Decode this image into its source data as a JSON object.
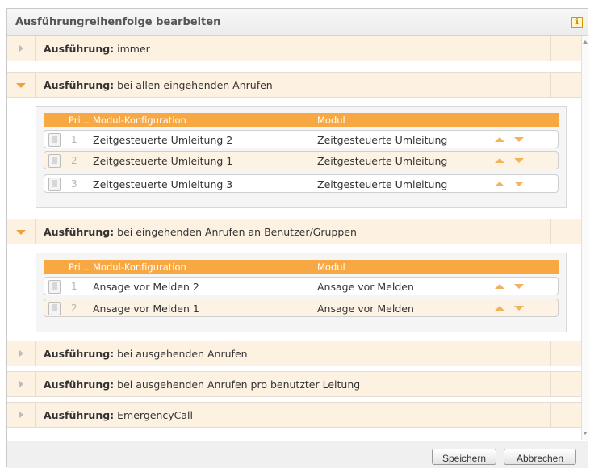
{
  "dialog": {
    "title": "Ausführungreihenfolge bearbeiten",
    "info_icon": "i"
  },
  "groups": [
    {
      "prefix": "Ausführung:",
      "name": "immer",
      "expanded": false
    },
    {
      "prefix": "Ausführung:",
      "name": "bei allen eingehenden Anrufen",
      "expanded": true,
      "columns": {
        "priority": "Pri...",
        "config": "Modul-Konfiguration",
        "module": "Modul"
      },
      "rows": [
        {
          "prio": "1",
          "config": "Zeitgesteuerte Umleitung 2",
          "module": "Zeitgesteuerte Umleitung"
        },
        {
          "prio": "2",
          "config": "Zeitgesteuerte Umleitung 1",
          "module": "Zeitgesteuerte Umleitung"
        },
        {
          "prio": "3",
          "config": "Zeitgesteuerte Umleitung 3",
          "module": "Zeitgesteuerte Umleitung"
        }
      ]
    },
    {
      "prefix": "Ausführung:",
      "name": "bei eingehenden Anrufen an Benutzer/Gruppen",
      "expanded": true,
      "columns": {
        "priority": "Pri...",
        "config": "Modul-Konfiguration",
        "module": "Modul"
      },
      "rows": [
        {
          "prio": "1",
          "config": "Ansage vor Melden 2",
          "module": "Ansage vor Melden"
        },
        {
          "prio": "2",
          "config": "Ansage vor Melden 1",
          "module": "Ansage vor Melden"
        }
      ]
    },
    {
      "prefix": "Ausführung:",
      "name": "bei ausgehenden Anrufen",
      "expanded": false
    },
    {
      "prefix": "Ausführung:",
      "name": "bei ausgehenden Anrufen pro benutzter Leitung",
      "expanded": false
    },
    {
      "prefix": "Ausführung:",
      "name": "EmergencyCall",
      "expanded": false
    }
  ],
  "footer": {
    "save_label": "Speichern",
    "cancel_label": "Abbrechen"
  },
  "icons": {
    "grip": "drag-handle-icon",
    "up": "move-up-icon",
    "down": "move-down-icon",
    "collapsed": "triangle-right-icon",
    "expanded": "triangle-down-icon"
  },
  "colors": {
    "accent": "#f8a842",
    "group_header_bg": "#fdf1e1",
    "alt_row_bg": "#fdf3e4"
  }
}
